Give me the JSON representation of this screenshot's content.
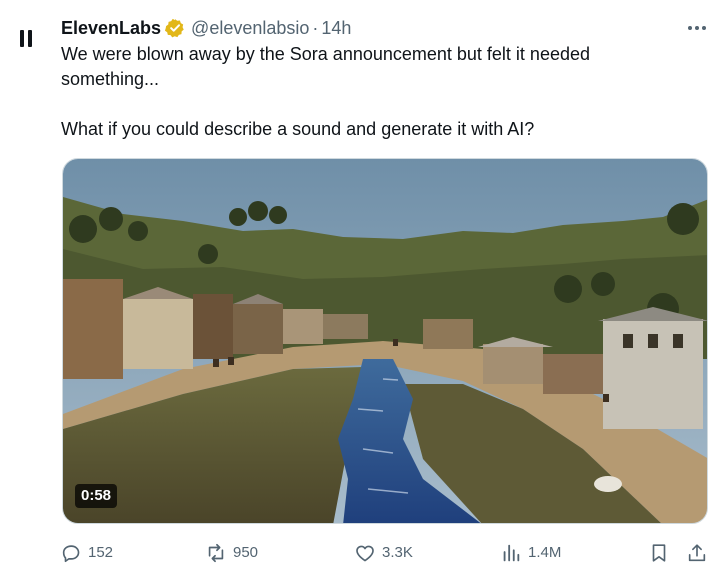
{
  "tweet": {
    "author_name": "ElevenLabs",
    "handle": "@elevenlabsio",
    "separator": "·",
    "time": "14h",
    "text_line1": "We were blown away by the Sora announcement but felt it needed",
    "text_line2": "something...",
    "text_line3": "What if you could describe a sound and generate it with AI?"
  },
  "media": {
    "video_duration": "0:58"
  },
  "actions": {
    "replies": "152",
    "reposts": "950",
    "likes": "3.3K",
    "views": "1.4M"
  },
  "colors": {
    "text": "#0f1419",
    "muted": "#536471",
    "verified_badge": "#e2b719"
  },
  "icons": [
    "pause-icon",
    "verified-badge-icon",
    "more-icon",
    "reply-icon",
    "repost-icon",
    "like-icon",
    "views-icon",
    "bookmark-icon",
    "share-icon"
  ]
}
